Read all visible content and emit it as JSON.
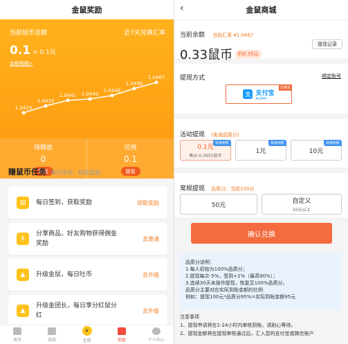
{
  "left": {
    "nav_title": "金鼠奖励",
    "header": {
      "total_label": "当前鼠币总额",
      "rate_label": "近7天兑换汇率",
      "total_value": "0.1",
      "approx_value": "≈ 0.1元",
      "details_link": "余额明细>"
    },
    "chart_data": {
      "type": "line",
      "values": [
        1.0423,
        1.0433,
        1.0441,
        1.0443,
        1.0448,
        1.0458,
        1.0467
      ],
      "labels": [
        "1.0423",
        "1.0433",
        "1.0441",
        "1.0443",
        "1.0448",
        "1.0458",
        "1.0467"
      ]
    },
    "pending": {
      "label": "待释放",
      "value": "0",
      "button": "释放"
    },
    "available": {
      "label": "可用",
      "value": "0.1",
      "button": "提现"
    },
    "tasks_title": "赚鼠币任务",
    "tasks_sub": "每日签到，获取奖励",
    "tasks": [
      {
        "text": "每日签到，获取奖励",
        "action": "领取奖励"
      },
      {
        "text": "分享商品，好友购物获得佣金奖励",
        "action": "去邀请"
      },
      {
        "text": "升级金鼠，每日吐币",
        "action": "去升级"
      },
      {
        "text": "升级金团长，每日享分红鼠分红",
        "action": "去升级"
      }
    ],
    "tabbar": [
      "首页",
      "商品",
      "金鼠",
      "奖励",
      "个人中心"
    ],
    "coin_glyph": "¥"
  },
  "right": {
    "nav_title": "金鼠商城",
    "back_glyph": "‹",
    "balance_label": "当前余额",
    "rate_text": "当前汇率 ¥1.0467",
    "balance_value": "0.33鼠币",
    "balance_yuan": "约0.35元",
    "records_button": "提现记录",
    "method_label": "提现方式",
    "bind_link": "绑定账号",
    "alipay_name": "支付宝",
    "alipay_en": "ALIPAY",
    "alipay_badge": "已绑定",
    "alipay_glyph": "支",
    "activity_title": "活动提现",
    "activity_sub": "(免减品质分)",
    "activity_amounts": [
      {
        "amount": "0.1元",
        "note": "售价:0.0955鼠币",
        "tag": "快速到账",
        "selected": true
      },
      {
        "amount": "1元",
        "note": "",
        "tag": "快速到账",
        "selected": false
      },
      {
        "amount": "10元",
        "note": "",
        "tag": "快速到账",
        "selected": false
      }
    ],
    "regular_title": "常规提现",
    "regular_sub": "品质分：当前100分",
    "regular_amounts": [
      {
        "amount": "50元",
        "note": ""
      },
      {
        "amount": "自定义",
        "note": "50元以上"
      }
    ],
    "confirm_button": "确认兑换",
    "info_lines": [
      "品质分说明：",
      "1.每人初始为100%品质分；",
      "2.提现每次-5%，签到+1%（最高90%）；",
      "3.连续30天未操作提现，恢复至100%品质分。",
      "品质分主要对应实际到账金额的比例",
      "例如：提现100元*品质分95%=实际到账金额95元"
    ],
    "notes_title": "注意事项",
    "notes": [
      "1、提现申请将在1-24小时内审核到账，请耐心等待。",
      "2、提现金额将在提现审核通过后，汇入您的支付宝或微信账户"
    ]
  },
  "colors": {
    "orange": "#ff9a10",
    "accent": "#f36b3e",
    "alipay": "#1a9bfc"
  }
}
